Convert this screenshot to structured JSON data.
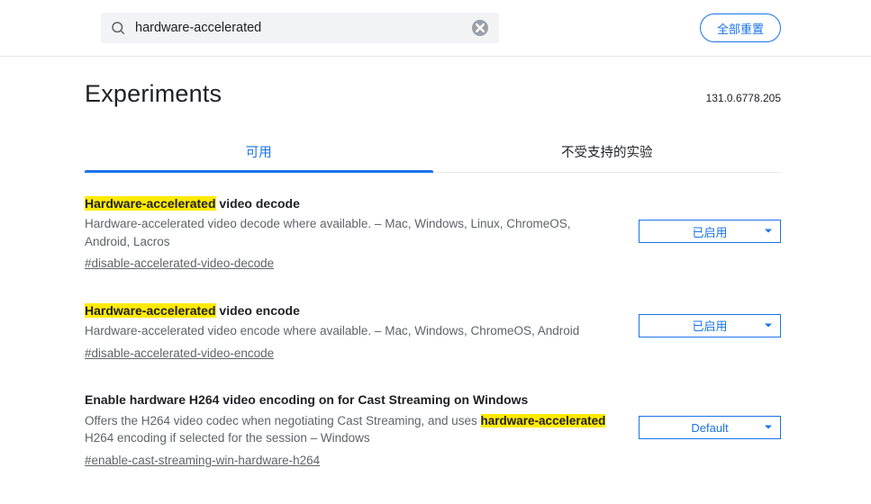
{
  "search": {
    "value": "hardware-accelerated"
  },
  "reset_button": "全部重置",
  "page_title": "Experiments",
  "version": "131.0.6778.205",
  "tabs": {
    "available": "可用",
    "unavailable": "不受支持的实验"
  },
  "flags": [
    {
      "title_pre_hl": "Hardware-accelerated",
      "title_post": " video decode",
      "desc": "Hardware-accelerated video decode where available. – Mac, Windows, Linux, ChromeOS, Android, Lacros",
      "hash": "#disable-accelerated-video-decode",
      "select": "已启用"
    },
    {
      "title_pre_hl": "Hardware-accelerated",
      "title_post": " video encode",
      "desc": "Hardware-accelerated video encode where available. – Mac, Windows, ChromeOS, Android",
      "hash": "#disable-accelerated-video-encode",
      "select": "已启用"
    },
    {
      "title_plain": "Enable hardware H264 video encoding on for Cast Streaming on Windows",
      "desc_pre": "Offers the H264 video codec when negotiating Cast Streaming, and uses ",
      "desc_hl1": "hardware-",
      "desc_mid": "",
      "desc_hl2": "accelerated",
      "desc_post": " H264 encoding if selected for the session – Windows",
      "hash": "#enable-cast-streaming-win-hardware-h264",
      "select": "Default"
    }
  ]
}
